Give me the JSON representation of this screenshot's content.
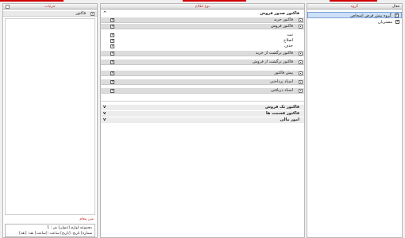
{
  "panels": {
    "left_title": "جزئیات",
    "mid_title": "نوع اطلاع",
    "right_title": "گروه",
    "right_col_active": "فعال"
  },
  "left": {
    "header_label": "فاکتور",
    "footer_title": "متن پیغام",
    "footer_line1": "مجموعه لوازم [عنوان] ش : 1",
    "footer_line2": "شماره] تاریخ: [تاریخ] ساعت: [ساعت] نقد: [نقد]"
  },
  "mid": {
    "sections": [
      {
        "label": "فاکتور صدور فروش",
        "items": [
          "فاکتور خرید",
          "فاکتور فروش"
        ]
      },
      {
        "label": "",
        "items": [
          "ثبت",
          "اصلاح",
          "حذف"
        ]
      },
      {
        "label": "",
        "items": [
          "فاکتور برگشت از خرید",
          "فاکتور برگشت از فروش"
        ]
      },
      {
        "label": "",
        "items": [
          "پیش فاکتور"
        ]
      },
      {
        "label": "",
        "items": [
          "اسناد پرداختی"
        ]
      },
      {
        "label": "",
        "items": [
          "اسناد دریافتی"
        ]
      }
    ],
    "lower": [
      "فاکتور تک فروش",
      "فاکتور قسمت ها",
      "امور مالی"
    ]
  },
  "right": {
    "groups": [
      {
        "label": "گروه پیش فرض اشخاص",
        "checked": true,
        "selected": true
      },
      {
        "label": "مشتریان",
        "checked": true,
        "selected": false
      }
    ]
  },
  "colors": {
    "accent_red": "#d00000",
    "label_red": "#c03030",
    "selection": "#cde0f7"
  }
}
